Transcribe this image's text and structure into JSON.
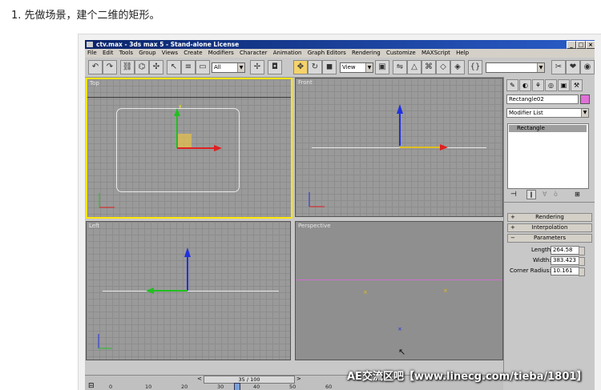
{
  "caption": "1. 先做场景，建个二维的矩形。",
  "window": {
    "title": "ctv.max - 3ds max 5 - Stand-alone License",
    "min": "_",
    "max": "□",
    "close": "×"
  },
  "menu": [
    "File",
    "Edit",
    "Tools",
    "Group",
    "Views",
    "Create",
    "Modifiers",
    "Character",
    "Animation",
    "Graph Editors",
    "Rendering",
    "Customize",
    "MAXScript",
    "Help"
  ],
  "toolbar": {
    "selection_filter": "All",
    "coord_system": "View"
  },
  "viewports": {
    "top": "Top",
    "front": "Front",
    "left": "Left",
    "perspective": "Perspective"
  },
  "command_panel": {
    "object_name": "Rectangle02",
    "modifier_list": "Modifier List",
    "stack_item": "Rectangle",
    "rollouts": {
      "rendering": "Rendering",
      "interpolation": "Interpolation",
      "parameters": "Parameters"
    },
    "params": {
      "length_label": "Length:",
      "length_value": "264.58",
      "width_label": "Width:",
      "width_value": "383.423",
      "radius_label": "Corner Radius:",
      "radius_value": "10.161"
    },
    "colors": {
      "object_color": "#e070d8"
    }
  },
  "timeline": {
    "frame": "35 / 100",
    "ticks": [
      "0",
      "10",
      "20",
      "30",
      "40",
      "50",
      "60"
    ]
  },
  "watermark": "AE交流区吧【www.linecg.com/tieba/1801】"
}
